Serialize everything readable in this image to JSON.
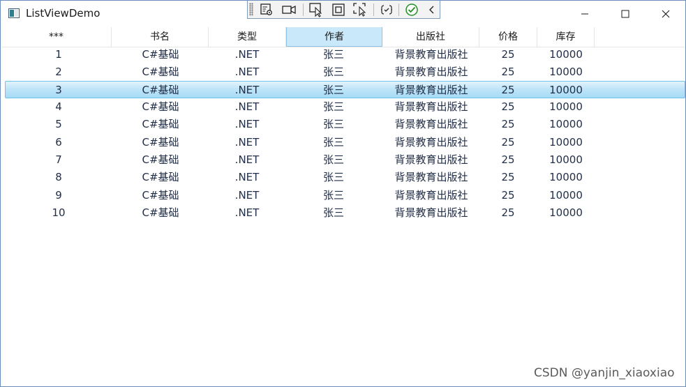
{
  "window": {
    "title": "ListViewDemo"
  },
  "columns": [
    "***",
    "书名",
    "类型",
    "作者",
    "出版社",
    "价格",
    "库存"
  ],
  "active_column_index": 3,
  "selected_row_index": 2,
  "rows": [
    [
      "1",
      "C#基础",
      ".NET",
      "张三",
      "背景教育出版社",
      "25",
      "10000"
    ],
    [
      "2",
      "C#基础",
      ".NET",
      "张三",
      "背景教育出版社",
      "25",
      "10000"
    ],
    [
      "3",
      "C#基础",
      ".NET",
      "张三",
      "背景教育出版社",
      "25",
      "10000"
    ],
    [
      "4",
      "C#基础",
      ".NET",
      "张三",
      "背景教育出版社",
      "25",
      "10000"
    ],
    [
      "5",
      "C#基础",
      ".NET",
      "张三",
      "背景教育出版社",
      "25",
      "10000"
    ],
    [
      "6",
      "C#基础",
      ".NET",
      "张三",
      "背景教育出版社",
      "25",
      "10000"
    ],
    [
      "7",
      "C#基础",
      ".NET",
      "张三",
      "背景教育出版社",
      "25",
      "10000"
    ],
    [
      "8",
      "C#基础",
      ".NET",
      "张三",
      "背景教育出版社",
      "25",
      "10000"
    ],
    [
      "9",
      "C#基础",
      ".NET",
      "张三",
      "背景教育出版社",
      "25",
      "10000"
    ],
    [
      "10",
      "C#基础",
      ".NET",
      "张三",
      "背景教育出版社",
      "25",
      "10000"
    ]
  ],
  "devtools": {
    "icons": [
      "live-visual-tree-icon",
      "video-camera-icon",
      "select-element-icon",
      "display-layout-adorners-icon",
      "track-focus-icon",
      "hot-reload-icon",
      "check-icon",
      "collapse-chevron-icon"
    ]
  },
  "watermark": "CSDN @yanjin_xiaoxiao",
  "colors": {
    "selection": "#bfe5f8",
    "selection_border": "#6fc0ea",
    "active_header": "#c9e8f9",
    "window_border": "#6c8ebf"
  }
}
